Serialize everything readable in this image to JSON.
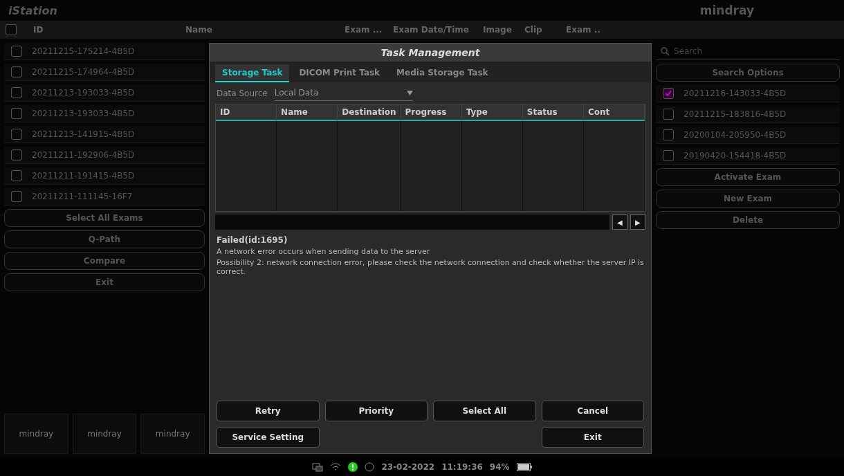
{
  "app": {
    "title": "iStation",
    "brand": "mindray"
  },
  "list_header": {
    "select_all_checked": false,
    "columns": [
      "ID",
      "Name",
      "Exam ...",
      "Exam Date/Time",
      "Image",
      "Clip",
      "Exam .."
    ]
  },
  "exam_list": {
    "rows": [
      {
        "id": "20211215-175214-4B5D",
        "checked": false
      },
      {
        "id": "20211215-174964-4B5D",
        "checked": false
      },
      {
        "id": "20211213-193033-4B5D",
        "checked": false
      },
      {
        "id": "20211213-193033-4B5D",
        "checked": false
      },
      {
        "id": "20211213-141915-4B5D",
        "checked": false
      },
      {
        "id": "20211211-192906-4B5D",
        "checked": false
      },
      {
        "id": "20211211-191415-4B5D",
        "checked": false
      },
      {
        "id": "20211211-111145-16F7",
        "checked": false
      }
    ]
  },
  "left_buttons": [
    "Select All Exams",
    "Q-Path",
    "Compare",
    "Exit"
  ],
  "thumbnails": [
    "mindray",
    "mindray",
    "mindray"
  ],
  "dialog": {
    "title": "Task Management",
    "tabs": [
      {
        "label": "Storage Task",
        "selected": true
      },
      {
        "label": "DICOM Print Task",
        "selected": false
      },
      {
        "label": "Media Storage Task",
        "selected": false
      }
    ],
    "data_source": {
      "label": "Data Source",
      "value": "Local Data"
    },
    "table": {
      "columns": [
        "ID",
        "Name",
        "Destination",
        "Progress",
        "Type",
        "Status",
        "Cont"
      ]
    },
    "pager": [
      "◀",
      "▶"
    ],
    "message_title": "Failed(id:1695)",
    "message_lines": [
      "A network error occurs when sending data to the server",
      "Possibility 2: network connection error, please check the network connection and check whether the server IP is correct."
    ],
    "buttons": [
      {
        "label": "Retry",
        "kind": "action"
      },
      {
        "label": "Priority",
        "kind": "action"
      },
      {
        "label": "Select All",
        "kind": "action"
      },
      {
        "label": "Cancel",
        "kind": "action"
      },
      {
        "label": "Service Setting",
        "kind": "action"
      },
      {
        "label": "Exit",
        "kind": "exit"
      }
    ]
  },
  "right_panel": {
    "search": {
      "placeholder": "Search"
    },
    "search_options": "Search Options",
    "rows": [
      {
        "id": "20211216-143033-4B5D",
        "checked": true
      },
      {
        "id": "20211215-183816-4B5D",
        "checked": false
      },
      {
        "id": "20200104-205950-4B5D",
        "checked": false
      },
      {
        "id": "20190420-154418-4B5D",
        "checked": false
      }
    ],
    "buttons": [
      "Activate Exam",
      "New Exam",
      "Delete"
    ]
  },
  "status_bar": {
    "date": "23-02-2022",
    "time": "11:19:36",
    "battery": "94%"
  }
}
